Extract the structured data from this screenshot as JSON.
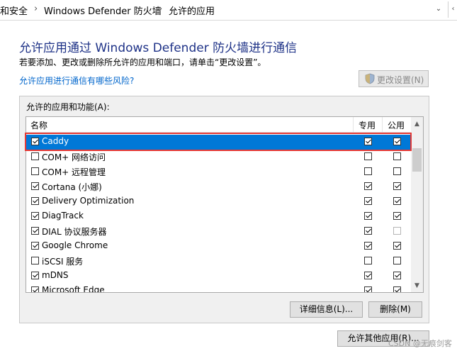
{
  "address_bar": {
    "crumb1": "和安全",
    "crumb2": "Windows Defender 防火墙",
    "crumb3": "允许的应用",
    "sep": "›",
    "dropdown": "⌄",
    "refresh": "‹"
  },
  "page": {
    "title": "允许应用通过 Windows Defender 防火墙进行通信",
    "description": "若要添加、更改或删除所允许的应用和端口，请单击“更改设置”。",
    "risk_link": "允许应用进行通信有哪些风险?",
    "change_settings_label": "更改设置(N)"
  },
  "apps_panel": {
    "label": "允许的应用和功能(A):",
    "columns": {
      "name": "名称",
      "private": "专用",
      "public": "公用"
    },
    "rows": [
      {
        "name": "Caddy",
        "enabled": true,
        "private": true,
        "public": true,
        "selected": true
      },
      {
        "name": "COM+ 网络访问",
        "enabled": false,
        "private": false,
        "public": false
      },
      {
        "name": "COM+ 远程管理",
        "enabled": false,
        "private": false,
        "public": false
      },
      {
        "name": "Cortana (小娜)",
        "enabled": true,
        "private": true,
        "public": true
      },
      {
        "name": "Delivery Optimization",
        "enabled": true,
        "private": true,
        "public": true
      },
      {
        "name": "DiagTrack",
        "enabled": true,
        "private": true,
        "public": true
      },
      {
        "name": "DIAL 协议服务器",
        "enabled": true,
        "private": true,
        "public": false,
        "public_disabled": true
      },
      {
        "name": "Google Chrome",
        "enabled": true,
        "private": true,
        "public": true
      },
      {
        "name": "iSCSI 服务",
        "enabled": false,
        "private": false,
        "public": false
      },
      {
        "name": "mDNS",
        "enabled": true,
        "private": true,
        "public": true
      },
      {
        "name": "Microsoft Edge",
        "enabled": true,
        "private": true,
        "public": true
      }
    ],
    "details_button": "详细信息(L)...",
    "remove_button": "删除(M)"
  },
  "allow_other_button": "允许其他应用(R)...",
  "watermark": "CSDN @无痕剑客"
}
